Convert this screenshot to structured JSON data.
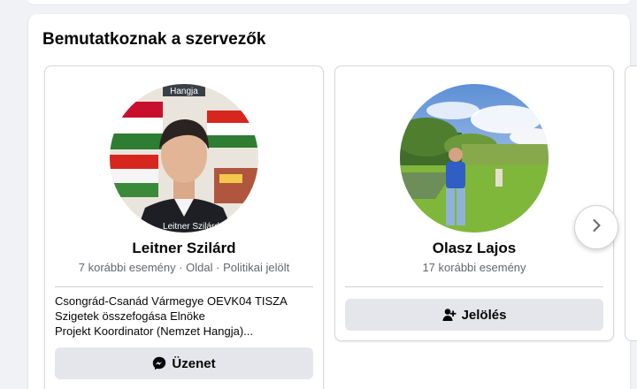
{
  "section": {
    "title": "Bemutatkoznak a szervezők"
  },
  "organizers": [
    {
      "name": "Leitner Szilárd",
      "meta": "7 korábbi esemény · Oldal · Politikai jelölt",
      "bio": [
        "Csongrád-Csanád Vármegye OEVK04 TISZA",
        "Szigetek összefogása Elnöke",
        "Projekt Koordinator (Nemzet Hangja)..."
      ],
      "avatar_overlay_top": "Hangja",
      "avatar_overlay_bottom": "Leitner Szilárd",
      "button": {
        "label": "Üzenet",
        "icon": "messenger-icon"
      }
    },
    {
      "name": "Olasz Lajos",
      "meta": "17 korábbi esemény",
      "button": {
        "label": "Jelölés",
        "icon": "add-friend-icon"
      }
    }
  ],
  "carousel": {
    "next_icon": "chevron-right-icon"
  },
  "colors": {
    "button_bg": "#e4e6eb",
    "secondary_text": "#65676b",
    "page_bg": "#f0f2f5"
  }
}
